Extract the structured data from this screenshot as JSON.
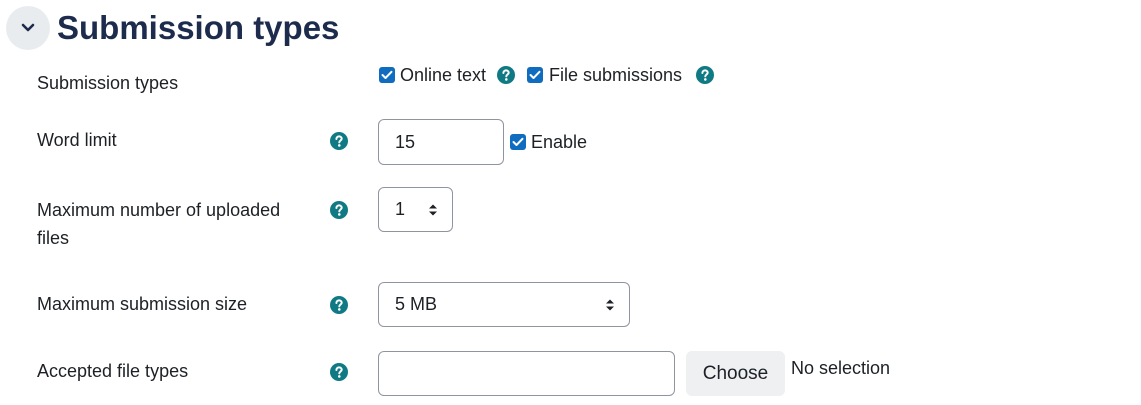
{
  "section": {
    "title": "Submission types",
    "collapse_icon": "chevron-down-icon"
  },
  "colors": {
    "accent": "#0f6cbf",
    "help": "#0f7a83",
    "title": "#1d2b4d"
  },
  "fields": {
    "submission_types": {
      "label": "Submission types",
      "options": [
        {
          "label": "Online text",
          "checked": true
        },
        {
          "label": "File submissions",
          "checked": true
        }
      ]
    },
    "word_limit": {
      "label": "Word limit",
      "value": "15",
      "enable_label": "Enable",
      "enabled": true
    },
    "max_uploaded_files": {
      "label": "Maximum number of uploaded files",
      "selected": "1"
    },
    "max_submission_size": {
      "label": "Maximum submission size",
      "selected": "5 MB"
    },
    "accepted_file_types": {
      "label": "Accepted file types",
      "value": "",
      "choose_label": "Choose",
      "selection_text": "No selection"
    }
  }
}
